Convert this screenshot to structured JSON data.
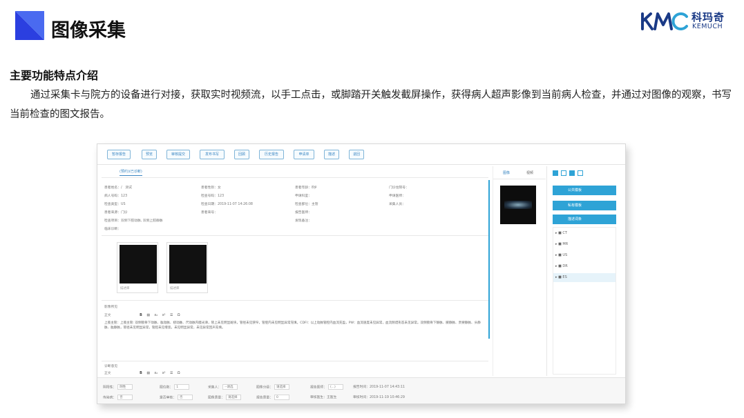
{
  "header": {
    "title": "图像采集",
    "brand_name_cn": "科玛奇",
    "brand_name_en": "KEMUCH"
  },
  "section": {
    "heading": "主要功能特点介绍",
    "paragraph": "通过采集卡与院方的设备进行对接，获取实时视频流，以手工点击，或脚踏开关触发截屏操作，获得病人超声影像到当前病人检查，并通过对图像的观察，书写当前检查的图文报告。"
  },
  "app": {
    "toolbar": [
      "暂存报告",
      "预览",
      "审核提交",
      "发布书写",
      "回顾",
      "历史报告",
      "申请单",
      "描述",
      "退回"
    ],
    "report_tab": "(预约)(已诊断)",
    "patient": [
      [
        "患者姓名：/　测试",
        "患者性别：女",
        "患者年龄：8岁",
        "门诊住院号："
      ],
      [
        "病人号码：123",
        "检查号码：123",
        "申请科室：",
        "申请医师："
      ],
      [
        "检查类型：US",
        "检查日期：2019-11-07 14:26:08",
        "检查部位：主管",
        "采集人员："
      ],
      [
        "患者来源：门诊",
        "患者来号：",
        "报告医师：",
        ""
      ],
      [
        "检查项目：双侧下肢动脉, 双侧上肢静脉",
        "",
        "发现备注：",
        ""
      ],
      [
        "临床诊断：",
        "",
        "",
        ""
      ]
    ],
    "thumbs": [
      "描述库",
      "描述库"
    ],
    "findings_label": "影像所见",
    "editor_font": "正文",
    "findings_text": "上肢主管：上肢主管: 双侧锁骨下动脉、肱动脉、桡动脉、尺动脉内膜光滑，管上未见明显斑块，管径未见狭窄，管腔内未见明显异常充填。CDFI：以上动脉管腔内血流充盈，PW：血流速度未见异常，血流频谱形态未见异常。双侧锁骨下静脉、腋静脉、贵要静脉、头静脉、肱静脉，管径未见明显异常，管腔未见增宽，未见明显异常，未见异常回声充填。",
    "conclusion_label": "诊断意见",
    "side_tabs": [
      "图像",
      "视频"
    ],
    "tree_buttons": [
      "公共模板",
      "私有模板",
      "描述词条"
    ],
    "tree_items": [
      "CT",
      "MR",
      "US",
      "DR",
      "ES"
    ],
    "footer_row1": [
      [
        "阴阳性：",
        "阴性"
      ],
      [
        "图位数：",
        "1"
      ],
      [
        "采集人：",
        "--请选"
      ],
      [
        "图像分级：",
        "请选择"
      ],
      [
        "报告医师：",
        "(...)"
      ],
      [
        "报告时间：",
        "2019-11-07 14:43:11"
      ]
    ],
    "footer_row2": [
      [
        "传染病：",
        "否"
      ],
      [
        "是否审核：",
        "否"
      ],
      [
        "图像质量：",
        "请选择"
      ],
      [
        "报告质量：",
        "0"
      ],
      [
        "审核医生：",
        "王医生"
      ],
      [
        "审核时间：",
        "2019-11-19 10:46:29"
      ]
    ]
  }
}
